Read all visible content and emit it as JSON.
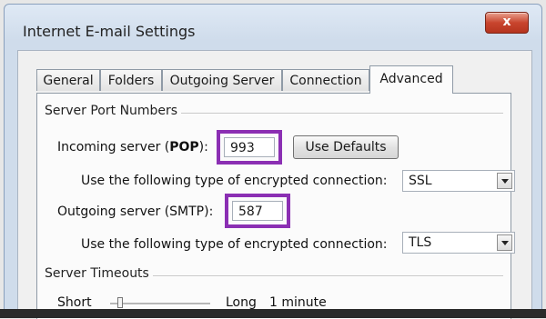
{
  "window": {
    "title": "Internet E-mail Settings",
    "close_label": "x"
  },
  "tabs": [
    {
      "label": "General"
    },
    {
      "label": "Folders"
    },
    {
      "label": "Outgoing Server"
    },
    {
      "label": "Connection"
    },
    {
      "label": "Advanced",
      "active": true
    }
  ],
  "ports": {
    "section_title": "Server Port Numbers",
    "incoming_label_pre": "Incoming server (",
    "incoming_label_bold": "POP",
    "incoming_label_post": "):",
    "incoming_value": "993",
    "use_defaults_label": "Use Defaults",
    "incoming_encryption_label": "Use the following type of encrypted connection:",
    "incoming_encryption_value": "SSL",
    "outgoing_label": "Outgoing server (SMTP):",
    "outgoing_value": "587",
    "outgoing_encryption_label": "Use the following type of encrypted connection:",
    "outgoing_encryption_value": "TLS"
  },
  "timeouts": {
    "section_title": "Server Timeouts",
    "short_label": "Short",
    "long_label": "Long",
    "value_label": "1 minute"
  },
  "colors": {
    "highlight": "#8b2fb3",
    "close_button": "#c9452e"
  }
}
